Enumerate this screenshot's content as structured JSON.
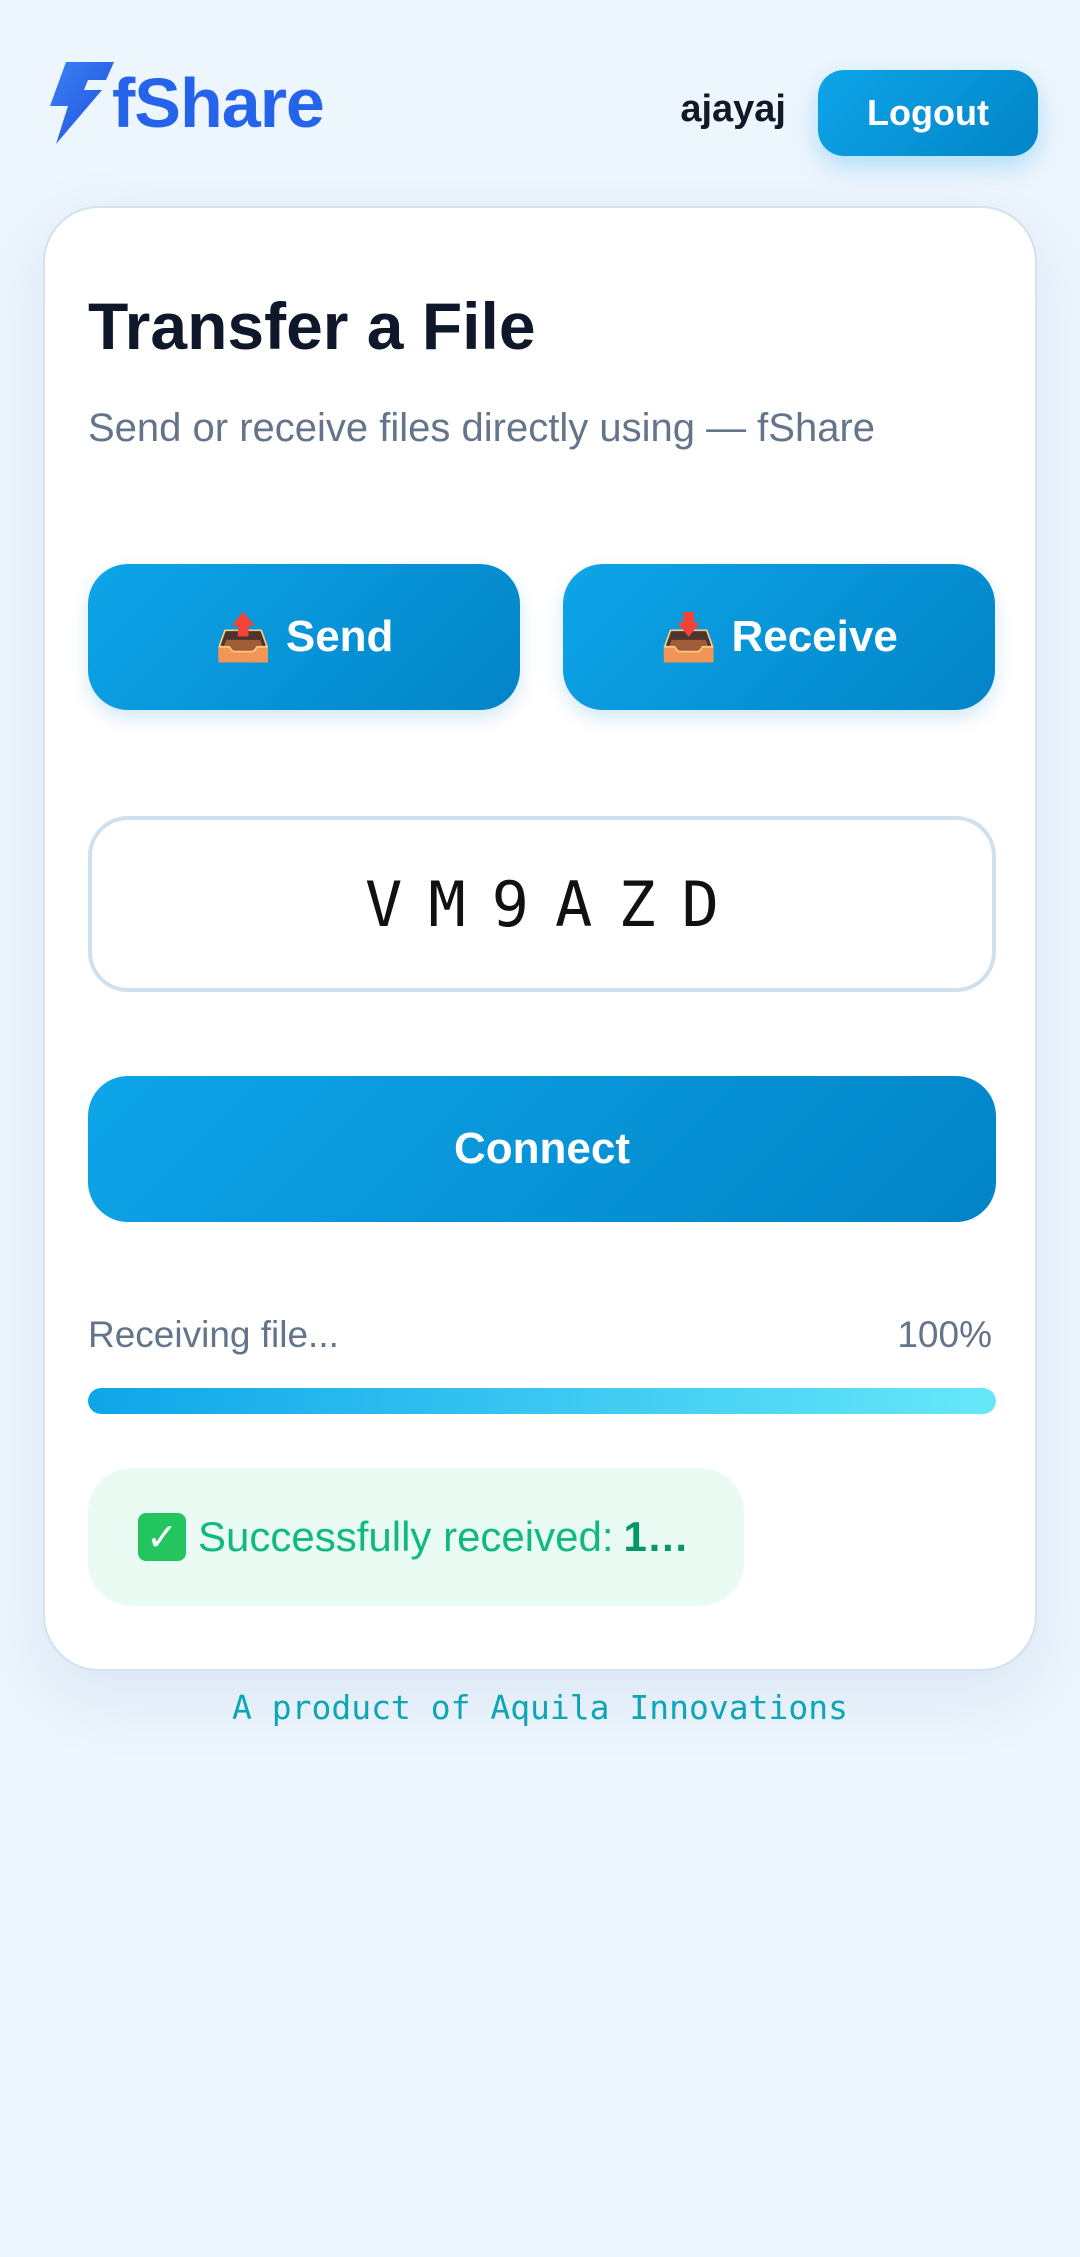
{
  "header": {
    "logo_text": "fShare",
    "username": "ajayaj",
    "logout_label": "Logout"
  },
  "card": {
    "title": "Transfer a File",
    "subtitle": "Send or receive files directly using — fShare",
    "send_emoji": "📤",
    "send_label": "Send",
    "receive_emoji": "📥",
    "receive_label": "Receive",
    "code_value": "VM9AZD",
    "connect_label": "Connect",
    "progress_label": "Receiving file...",
    "progress_percent_text": "100%",
    "progress_value": 1.0,
    "success_prefix": "Successfully received:",
    "success_value": "1…"
  },
  "footer": {
    "text": "A product of Aquila Innovations"
  },
  "colors": {
    "accent": "#0ea5e9",
    "accent_dark": "#0284c7",
    "brand": "#2563eb",
    "success": "#10b981",
    "page_bg": "#edf5fd"
  }
}
